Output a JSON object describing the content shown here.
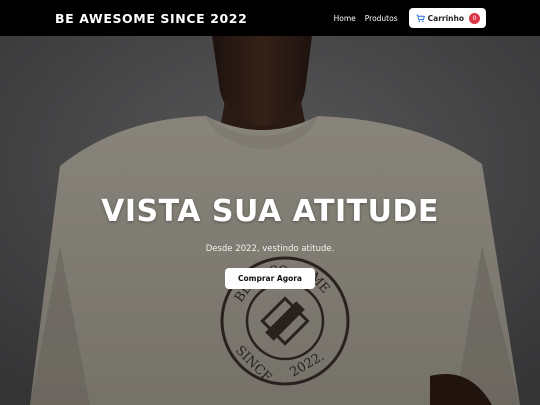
{
  "navbar": {
    "brand": "BE AWESOME SINCE 2022",
    "links": [
      "Home",
      "Produtos"
    ],
    "cart": {
      "label": "Carrinho",
      "count": "0",
      "icon": "cart-icon"
    }
  },
  "hero": {
    "title": "VISTA SUA ATITUDE",
    "subtitle": "Desde 2022, vestindo atitude.",
    "cta_label": "Comprar Agora",
    "image_logo_text": "BE AWESOME SINCE 2022"
  },
  "colors": {
    "navbar_bg": "#000000",
    "badge": "#dc3545",
    "button_bg": "#ffffff"
  }
}
